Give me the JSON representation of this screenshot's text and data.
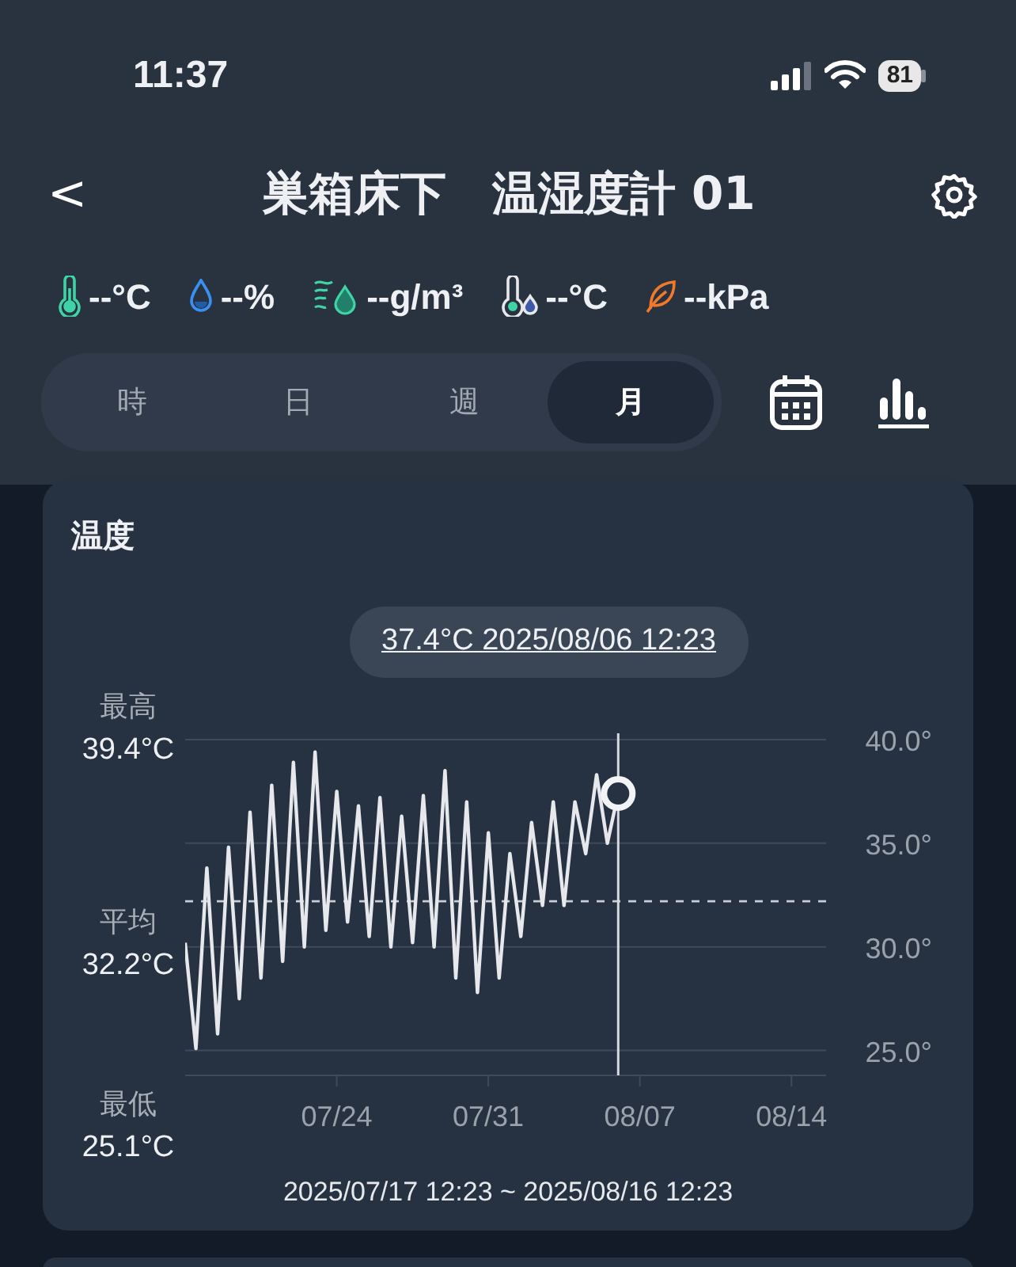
{
  "status_bar": {
    "time": "11:37",
    "battery": "81"
  },
  "header": {
    "back": "<",
    "title": "巣箱床下　温湿度計 01"
  },
  "readings": [
    {
      "kind": "temperature",
      "value": "--°C"
    },
    {
      "kind": "humidity",
      "value": "--%"
    },
    {
      "kind": "absolute-humidity",
      "value": "--g/m³"
    },
    {
      "kind": "dew-point",
      "value": "--°C"
    },
    {
      "kind": "vpd",
      "value": "--kPa"
    }
  ],
  "period_tabs": [
    {
      "label": "時",
      "selected": false
    },
    {
      "label": "日",
      "selected": false
    },
    {
      "label": "週",
      "selected": false
    },
    {
      "label": "月",
      "selected": true
    }
  ],
  "card": {
    "title": "温度",
    "stats": [
      {
        "label": "最高",
        "value": "39.4°C"
      },
      {
        "label": "平均",
        "value": "32.2°C"
      },
      {
        "label": "最低",
        "value": "25.1°C"
      }
    ],
    "range": "2025/07/17 12:23 ~ 2025/08/16 12:23",
    "chart_data": {
      "type": "line",
      "ylim": [
        23.8,
        40
      ],
      "categories": [
        null,
        null,
        null,
        null,
        null,
        null,
        null,
        null,
        null,
        null,
        null,
        null,
        null,
        null,
        "07/24",
        null,
        null,
        null,
        null,
        null,
        null,
        null,
        null,
        null,
        null,
        null,
        null,
        null,
        "07/31",
        null,
        null,
        null,
        null,
        null,
        null,
        null,
        null,
        null,
        null,
        null,
        null,
        null,
        "08/07",
        null,
        null,
        null,
        null,
        null,
        null,
        null,
        null,
        null,
        null,
        null,
        null,
        null,
        "08/14",
        null,
        null,
        null
      ],
      "yticks": [
        {
          "value": 25,
          "label": "25.0°"
        },
        {
          "value": 30,
          "label": "30.0°"
        },
        {
          "value": 35,
          "label": "35.0°"
        },
        {
          "value": 40,
          "label": "40.0°"
        }
      ],
      "values": [
        30.2,
        25.1,
        33.8,
        25.8,
        34.8,
        27.5,
        36.5,
        28.5,
        37.8,
        29.3,
        38.9,
        30.0,
        39.4,
        30.8,
        37.5,
        31.2,
        36.8,
        30.5,
        37.2,
        30.0,
        36.3,
        30.2,
        37.3,
        30.0,
        38.5,
        28.5,
        37.0,
        27.8,
        35.5,
        28.5,
        34.5,
        30.5,
        36.0,
        32.0,
        37.0,
        32.0,
        37.0,
        34.5,
        38.3,
        35.0,
        37.4,
        null,
        null,
        null,
        null,
        null,
        null,
        null,
        null,
        null,
        null,
        null,
        null,
        null,
        null,
        null,
        null,
        null,
        null,
        null
      ],
      "grid": true,
      "ref_lines": [
        {
          "axis": "y",
          "value": 32.2
        }
      ],
      "annotations": [
        "37.4°C 2025/08/06 12:23"
      ]
    }
  }
}
